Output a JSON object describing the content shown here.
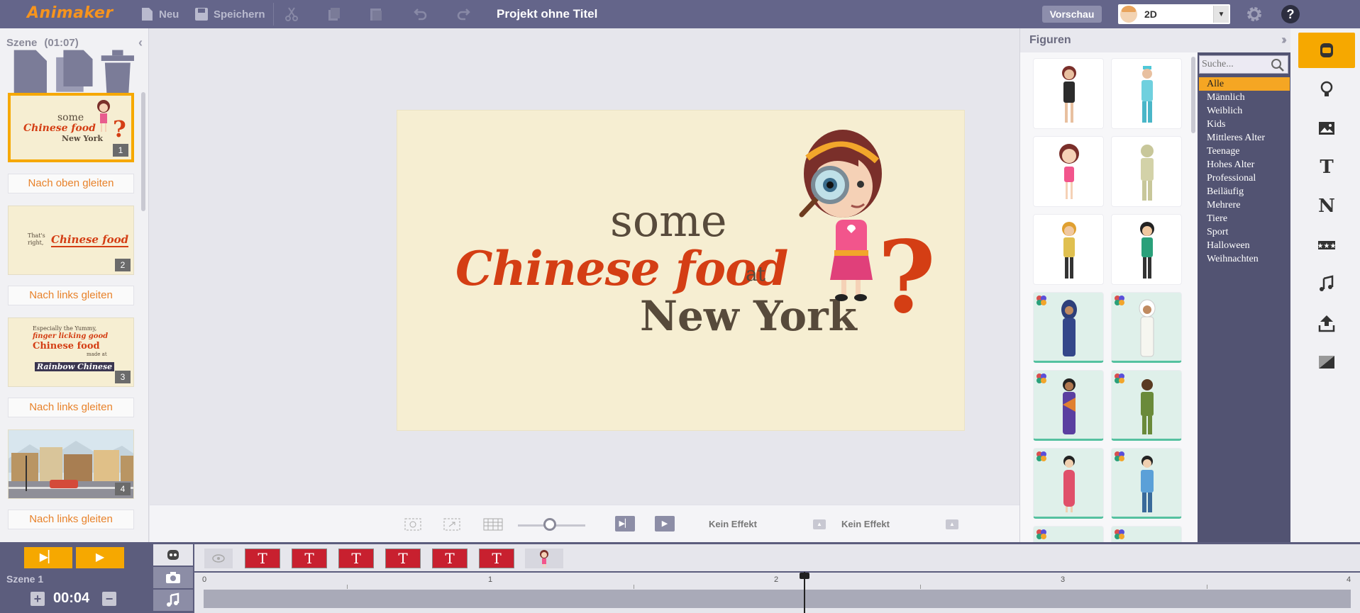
{
  "app": {
    "logo": "Animaker",
    "project_title": "Projekt ohne Titel"
  },
  "toolbar": {
    "new_label": "Neu",
    "save_label": "Speichern",
    "preview_label": "Vorschau",
    "mode_value": "2D"
  },
  "scenes": {
    "header": "Szene",
    "duration": "(01:07)",
    "items": [
      {
        "num": "1",
        "transition": "Nach oben gleiten",
        "t1": "some",
        "t2": "Chinese food",
        "t3": "New York"
      },
      {
        "num": "2",
        "transition": "Nach links gleiten",
        "t1": "That's right,",
        "t2": "Chinese food"
      },
      {
        "num": "3",
        "transition": "Nach links gleiten",
        "t1": "Especially the Yummy,",
        "t2": "finger licking good",
        "t3": "Chinese food",
        "t4": "made at",
        "t5": "Rainbow Chinese"
      },
      {
        "num": "4",
        "transition": "Nach links gleiten"
      }
    ]
  },
  "stage": {
    "line1": "some",
    "line2": "Chinese food",
    "line2b": "at",
    "line3": "New York",
    "mark": "?"
  },
  "canvas_controls": {
    "effect_in": "Kein Effekt",
    "effect_out": "Kein Effekt"
  },
  "characters": {
    "header": "Figuren",
    "search_placeholder": "Suche...",
    "categories": [
      "Alle",
      "Männlich",
      "Weiblich",
      "Kids",
      "Mittleres Alter",
      "Teenage",
      "Hohes Alter",
      "Professional",
      "Beiläufig",
      "Mehrere",
      "Tiere",
      "Sport",
      "Halloween",
      "Weihnachten"
    ]
  },
  "timeline": {
    "scene_label": "Szene 1",
    "time": "00:04",
    "text_item": "T",
    "ruler": [
      "0",
      "1",
      "2",
      "3",
      "4"
    ]
  },
  "colors": {
    "accent": "#f6a800",
    "topbar": "#64658a",
    "brand_red": "#d43e14",
    "timeline_item": "#c8202f"
  }
}
